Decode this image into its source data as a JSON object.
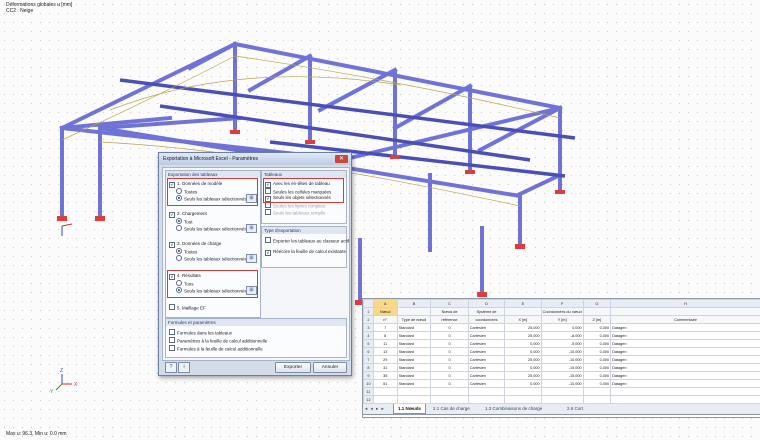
{
  "viewport": {
    "title_line1": "Déformations globales u [mm]",
    "title_line2": "CC2 : Neige",
    "footer": "Max u: 96.3, Min u: 0.0 mm",
    "axis_labels": [
      "X",
      "Y",
      "Z"
    ]
  },
  "dialog": {
    "title": "Exportation à Microsoft Excel - Paramètres",
    "close_symbol": "✕",
    "export_group": {
      "header": "Exportation des tableaux",
      "sections": [
        {
          "label": "1. Données de modèle",
          "checked": true,
          "options": [
            "Toutes",
            "Seuls les tableaux sélectionnés"
          ],
          "selected": 1
        },
        {
          "label": "2. Chargement",
          "checked": true,
          "options": [
            "Tout",
            "Seuls les tableaux sélectionnés"
          ],
          "selected": 0
        },
        {
          "label": "3. Données de charge",
          "checked": true,
          "options": [
            "Toutes",
            "Seuls les tableaux sélectionnés"
          ],
          "selected": 0
        },
        {
          "label": "4. Résultats",
          "checked": true,
          "options": [
            "Tous",
            "Seuls les tableaux sélectionnés"
          ],
          "selected": 1
        },
        {
          "label": "5. Maillage EF",
          "checked": false,
          "options": [],
          "selected": null
        }
      ]
    },
    "tables_group": {
      "header": "Tableaux",
      "options": [
        {
          "label": "Avec les en-têtes de tableau",
          "checked": true,
          "disabled": false
        },
        {
          "label": "Seules les cellules marquées",
          "checked": false,
          "disabled": false
        },
        {
          "label": "Seuls les objets sélectionnés",
          "checked": true,
          "disabled": false
        },
        {
          "label": "Seules les lignes remplies",
          "checked": false,
          "disabled": true
        },
        {
          "label": "Seuls les tableaux remplis",
          "checked": false,
          "disabled": true
        }
      ]
    },
    "export_type_group": {
      "header": "Type d'exportation",
      "options": [
        {
          "label": "Exporter les tableaux au classeur actif",
          "checked": false
        },
        {
          "label": "Réécrire la feuille de calcul existante",
          "checked": true
        }
      ]
    },
    "formulas_group": {
      "header": "Formules et paramètres",
      "options": [
        {
          "label": "Formules dans les tableaux",
          "checked": false
        },
        {
          "label": "Paramètres à la feuille de calcul additionnelle",
          "checked": false
        },
        {
          "label": "Formules à la feuille de calcul additionnelle",
          "checked": false
        }
      ]
    },
    "buttons": {
      "export": "Exporter",
      "cancel": "Annuler",
      "help_icon": "?",
      "info_icon": "i"
    }
  },
  "sheet": {
    "columns": [
      "A",
      "B",
      "C",
      "D",
      "E",
      "F",
      "G",
      "H"
    ],
    "header_row1": [
      "Nœud",
      "",
      "Nœud de",
      "Système de",
      "",
      "Coordonnées du nœud",
      "",
      ""
    ],
    "header_row2": [
      "n°",
      "Type de nœud",
      "référence",
      "coordonnées",
      "X [m]",
      "Y [m]",
      "Z [m]",
      "Commentaire"
    ],
    "rows": [
      [
        "7",
        "Standard",
        "0",
        "Cartésien",
        "25,000",
        "0,000",
        "0,000",
        "Datagen"
      ],
      [
        "8",
        "Standard",
        "0",
        "Cartésien",
        "25,000",
        "-8,000",
        "0,000",
        "Datagen"
      ],
      [
        "11",
        "Standard",
        "0",
        "Cartésien",
        "0,000",
        "-5,000",
        "0,000",
        "Datagen"
      ],
      [
        "13",
        "Standard",
        "0",
        "Cartésien",
        "0,000",
        "-10,000",
        "0,000",
        "Datagen"
      ],
      [
        "29",
        "Standard",
        "0",
        "Cartésien",
        "25,000",
        "-10,000",
        "0,000",
        "Datagen"
      ],
      [
        "31",
        "Standard",
        "0",
        "Cartésien",
        "0,000",
        "-15,000",
        "0,000",
        "Datagen"
      ],
      [
        "35",
        "Standard",
        "0",
        "Cartésien",
        "25,000",
        "-15,000",
        "0,000",
        "Datagen"
      ],
      [
        "51",
        "Standard",
        "0",
        "Cartésien",
        "0,000",
        "-10,000",
        "0,000",
        "Datagen"
      ]
    ],
    "row_numbers": [
      "1",
      "2",
      "3",
      "4",
      "5",
      "6",
      "7",
      "8",
      "9",
      "10",
      "11",
      "12"
    ],
    "tabs": [
      "1.1 Nœuds",
      "2.1 Cas de charge",
      "1.3 Combinaisons de charge",
      "2.6 Cort"
    ],
    "nav_arrows": "◂ ◂ ▸ ▸"
  },
  "colors": {
    "member": "#6f73d8",
    "support": "#e23b3b",
    "highlight": "#d23a3a",
    "axis_green": "#2a9a2a"
  }
}
